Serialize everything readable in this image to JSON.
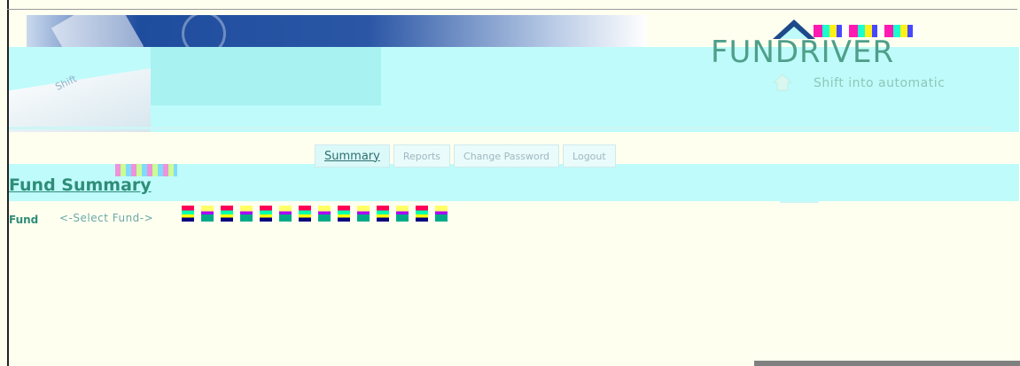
{
  "brand": {
    "logo_text": "FUNDRIVER",
    "tagline": "Shift into automatic",
    "banner_card_text": "Shift"
  },
  "nav": {
    "tabs": [
      {
        "label": "Summary",
        "active": true
      },
      {
        "label": "Reports",
        "active": false
      },
      {
        "label": "Change Password",
        "active": false
      },
      {
        "label": "Logout",
        "active": false
      }
    ]
  },
  "page": {
    "title": "Fund Summary"
  },
  "fund_selector": {
    "label": "Fund",
    "selected": "<-Select Fund->"
  },
  "colors": {
    "accent_teal": "#2f8d78",
    "band_cyan": "#bffbfb",
    "background": "#fffff0",
    "banner_blue": "#1f4d9e"
  }
}
